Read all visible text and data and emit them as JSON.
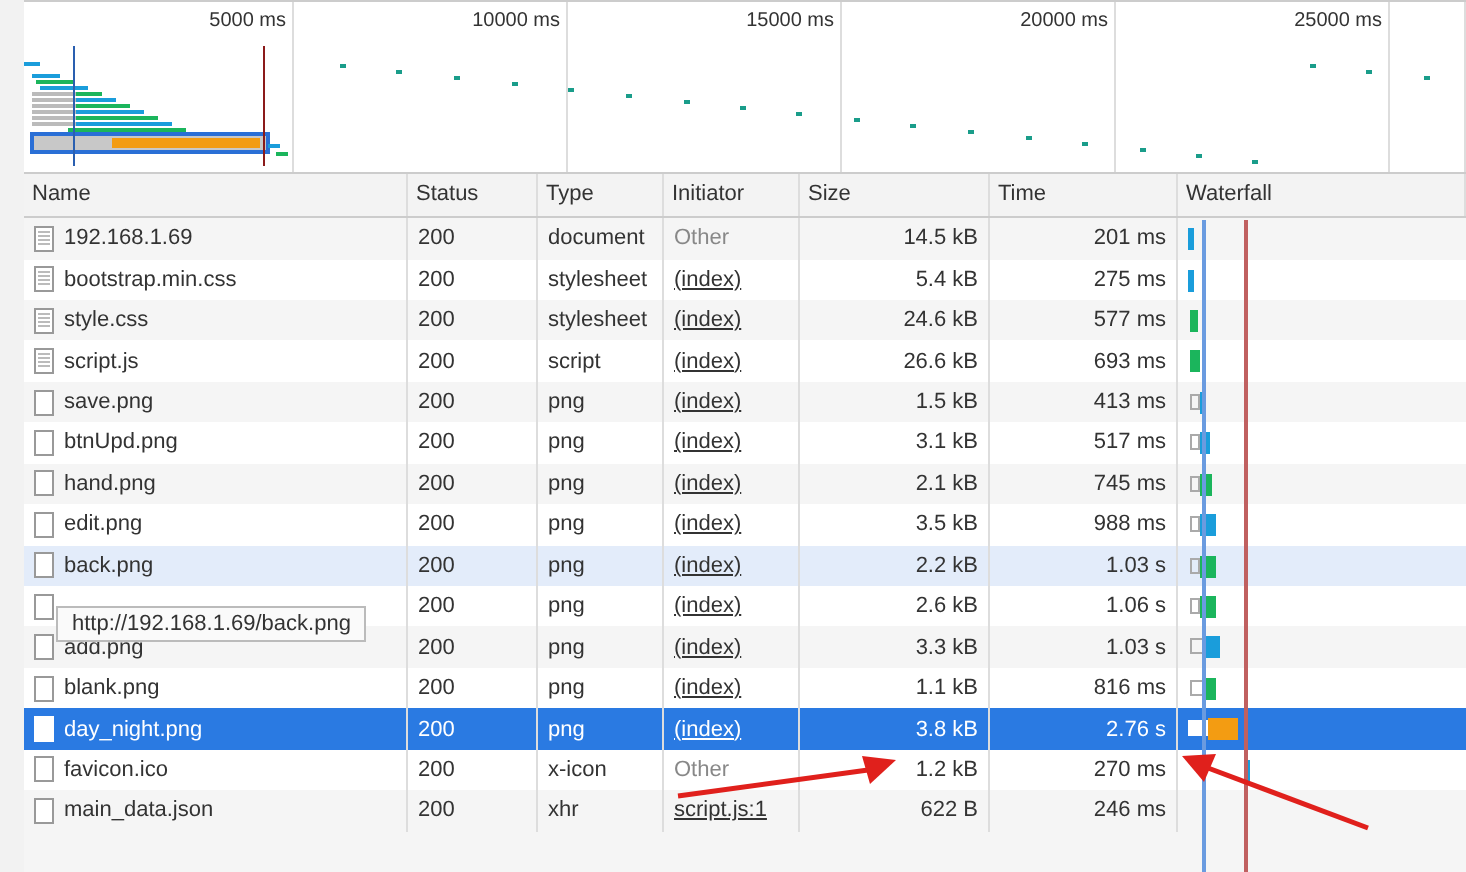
{
  "overview": {
    "ticks": [
      "5000 ms",
      "10000 ms",
      "15000 ms",
      "20000 ms",
      "25000 ms"
    ]
  },
  "table": {
    "columns": [
      "Name",
      "Status",
      "Type",
      "Initiator",
      "Size",
      "Time",
      "Waterfall"
    ],
    "rows": [
      {
        "kind": "textfile",
        "name": "192.168.1.69",
        "status": "200",
        "type": "document",
        "initiator": "Other",
        "initiator_link": false,
        "size": "14.5 kB",
        "time": "201 ms",
        "selected": false,
        "hovered": false
      },
      {
        "kind": "textfile",
        "name": "bootstrap.min.css",
        "status": "200",
        "type": "stylesheet",
        "initiator": "(index)",
        "initiator_link": true,
        "size": "5.4 kB",
        "time": "275 ms",
        "selected": false,
        "hovered": false
      },
      {
        "kind": "textfile",
        "name": "style.css",
        "status": "200",
        "type": "stylesheet",
        "initiator": "(index)",
        "initiator_link": true,
        "size": "24.6 kB",
        "time": "577 ms",
        "selected": false,
        "hovered": false
      },
      {
        "kind": "textfile",
        "name": "script.js",
        "status": "200",
        "type": "script",
        "initiator": "(index)",
        "initiator_link": true,
        "size": "26.6 kB",
        "time": "693 ms",
        "selected": false,
        "hovered": false
      },
      {
        "kind": "blankfile",
        "name": "save.png",
        "status": "200",
        "type": "png",
        "initiator": "(index)",
        "initiator_link": true,
        "size": "1.5 kB",
        "time": "413 ms",
        "selected": false,
        "hovered": false
      },
      {
        "kind": "blankfile",
        "name": "btnUpd.png",
        "status": "200",
        "type": "png",
        "initiator": "(index)",
        "initiator_link": true,
        "size": "3.1 kB",
        "time": "517 ms",
        "selected": false,
        "hovered": false
      },
      {
        "kind": "blankfile",
        "name": "hand.png",
        "status": "200",
        "type": "png",
        "initiator": "(index)",
        "initiator_link": true,
        "size": "2.1 kB",
        "time": "745 ms",
        "selected": false,
        "hovered": false
      },
      {
        "kind": "blankfile",
        "name": "edit.png",
        "status": "200",
        "type": "png",
        "initiator": "(index)",
        "initiator_link": true,
        "size": "3.5 kB",
        "time": "988 ms",
        "selected": false,
        "hovered": false
      },
      {
        "kind": "blankfile",
        "name": "back.png",
        "status": "200",
        "type": "png",
        "initiator": "(index)",
        "initiator_link": true,
        "size": "2.2 kB",
        "time": "1.03 s",
        "selected": false,
        "hovered": true
      },
      {
        "kind": "blankfile",
        "status": "200",
        "type": "png",
        "initiator": "(index)",
        "initiator_link": true,
        "size": "2.6 kB",
        "time": "1.06 s",
        "selected": false,
        "hovered": false
      },
      {
        "kind": "blankfile",
        "name": "add.png",
        "status": "200",
        "type": "png",
        "initiator": "(index)",
        "initiator_link": true,
        "size": "3.3 kB",
        "time": "1.03 s",
        "selected": false,
        "hovered": false
      },
      {
        "kind": "blankfile",
        "name": "blank.png",
        "status": "200",
        "type": "png",
        "initiator": "(index)",
        "initiator_link": true,
        "size": "1.1 kB",
        "time": "816 ms",
        "selected": false,
        "hovered": false
      },
      {
        "kind": "blankfile",
        "name": "day_night.png",
        "status": "200",
        "type": "png",
        "initiator": "(index)",
        "initiator_link": true,
        "size": "3.8 kB",
        "time": "2.76 s",
        "selected": true,
        "hovered": false
      },
      {
        "kind": "blankfile",
        "name": "favicon.ico",
        "status": "200",
        "type": "x-icon",
        "initiator": "Other",
        "initiator_link": false,
        "size": "1.2 kB",
        "time": "270 ms",
        "selected": false,
        "hovered": false
      },
      {
        "kind": "blankfile",
        "name": "main_data.json",
        "status": "200",
        "type": "xhr",
        "initiator": "script.js:1",
        "initiator_link": true,
        "size": "622 B",
        "time": "246 ms",
        "selected": false,
        "hovered": false
      }
    ]
  },
  "tooltip": "http://192.168.1.69/back.png"
}
